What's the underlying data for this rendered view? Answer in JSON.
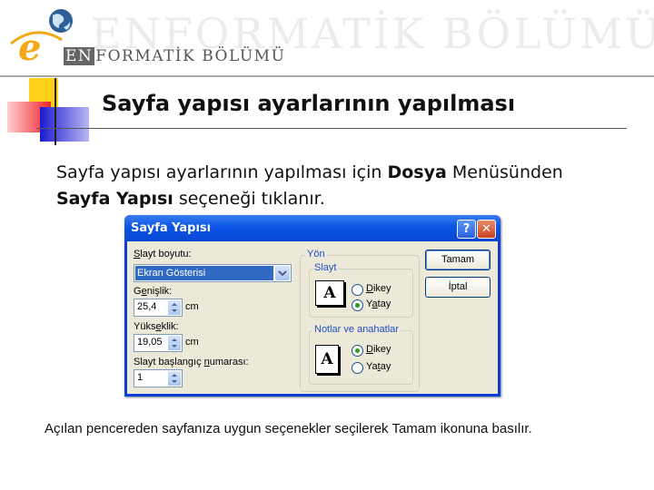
{
  "header": {
    "watermark": "ENFORMATİK BÖLÜMÜ",
    "brand_en": "EN",
    "brand_rest": "FORMATİK BÖLÜMÜ",
    "logo_letter": "e"
  },
  "slide": {
    "title": "Sayfa yapısı ayarlarının yapılması",
    "body_part1": "Sayfa yapısı ayarlarının yapılması için ",
    "body_bold1": "Dosya",
    "body_part2": " Menüsünden ",
    "body_bold2": "Sayfa Yapısı",
    "body_part3": " seçeneği tıklanır.",
    "footer": "Açılan pencereden sayfanıza uygun seçenekler seçilerek Tamam ikonuna basılır."
  },
  "dialog": {
    "title": "Sayfa Yapısı",
    "help_label": "?",
    "close_label": "✕",
    "slide_size_label_u": "S",
    "slide_size_label_rest": "layt boyutu:",
    "slide_size_value": "Ekran Gösterisi",
    "width_label_pre": "G",
    "width_label_u": "e",
    "width_label_rest": "nişlik:",
    "width_value": "25,4",
    "width_unit": "cm",
    "height_label_pre": "Yüks",
    "height_label_u": "e",
    "height_label_rest": "klik:",
    "height_value": "19,05",
    "height_unit": "cm",
    "start_label_pre": "Slayt başlangıç ",
    "start_label_u": "n",
    "start_label_rest": "umarası:",
    "start_value": "1",
    "orientation_group": "Yön",
    "slide_group": "Slayt",
    "slide_portrait_u": "D",
    "slide_portrait_rest": "ikey",
    "slide_landscape_pre": "Y",
    "slide_landscape_u": "a",
    "slide_landscape_rest": "tay",
    "notes_group": "Notlar ve anahatlar",
    "notes_portrait_u": "D",
    "notes_portrait_rest": "ikey",
    "notes_landscape_pre": "Ya",
    "notes_landscape_u": "t",
    "notes_landscape_rest": "ay",
    "icon_letter": "A",
    "ok_label": "Tamam",
    "cancel_label": "İptal",
    "slide_orientation_selected": "Yatay",
    "notes_orientation_selected": "Dikey"
  },
  "colors": {
    "titlebar": "#0a55e6",
    "selection": "#316ac5",
    "dialog_face": "#ece9d8",
    "radio_dot": "#21a121"
  }
}
